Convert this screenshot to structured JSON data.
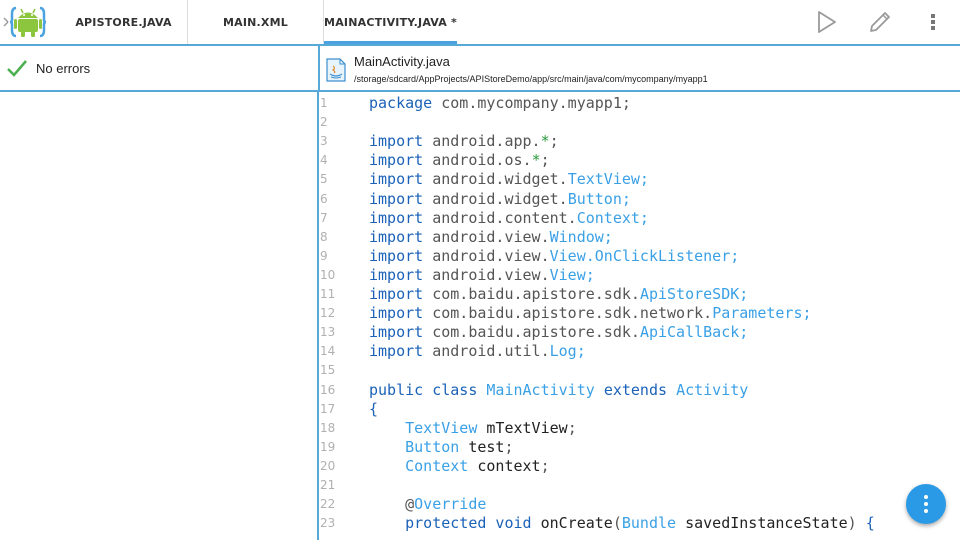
{
  "tabs": [
    {
      "label": "APISTORE.JAVA"
    },
    {
      "label": "MAIN.XML"
    },
    {
      "label": "MAINACTIVITY.JAVA *"
    }
  ],
  "toolbar": {
    "run_icon": "play-icon",
    "edit_icon": "pencil-icon",
    "menu_icon": "overflow-menu-icon"
  },
  "status": {
    "text": "No errors",
    "icon": "check-icon"
  },
  "file": {
    "name": "MainActivity.java",
    "path": "/storage/sdcard/AppProjects/APIStoreDemo/app/src/main/java/com/mycompany/myapp1",
    "icon": "java-file-icon"
  },
  "editor": {
    "lines": [
      {
        "n": "1",
        "html": "<span class='kw'>package</span> <span class='pl'>com.mycompany.myapp1;</span>"
      },
      {
        "n": "2",
        "html": ""
      },
      {
        "n": "3",
        "html": "<span class='kw'>import</span> <span class='pl'>android.app.</span><span class='gr'>*</span><span class='pl'>;</span>"
      },
      {
        "n": "4",
        "html": "<span class='kw'>import</span> <span class='pl'>android.os.</span><span class='gr'>*</span><span class='pl'>;</span>"
      },
      {
        "n": "5",
        "html": "<span class='kw'>import</span> <span class='pl'>android.widget.</span><span class='ty'>TextView;</span>"
      },
      {
        "n": "6",
        "html": "<span class='kw'>import</span> <span class='pl'>android.widget.</span><span class='ty'>Button;</span>"
      },
      {
        "n": "7",
        "html": "<span class='kw'>import</span> <span class='pl'>android.content.</span><span class='ty'>Context;</span>"
      },
      {
        "n": "8",
        "html": "<span class='kw'>import</span> <span class='pl'>android.view.</span><span class='ty'>Window;</span>"
      },
      {
        "n": "9",
        "html": "<span class='kw'>import</span> <span class='pl'>android.view.</span><span class='ty'>View.OnClickListener;</span>"
      },
      {
        "n": "10",
        "html": "<span class='kw'>import</span> <span class='pl'>android.view.</span><span class='ty'>View;</span>"
      },
      {
        "n": "11",
        "html": "<span class='kw'>import</span> <span class='pl'>com.baidu.apistore.sdk.</span><span class='ty'>ApiStoreSDK;</span>"
      },
      {
        "n": "12",
        "html": "<span class='kw'>import</span> <span class='pl'>com.baidu.apistore.sdk.network.</span><span class='ty'>Parameters;</span>"
      },
      {
        "n": "13",
        "html": "<span class='kw'>import</span> <span class='pl'>com.baidu.apistore.sdk.</span><span class='ty'>ApiCallBack;</span>"
      },
      {
        "n": "14",
        "html": "<span class='kw'>import</span> <span class='pl'>android.util.</span><span class='ty'>Log;</span>"
      },
      {
        "n": "15",
        "html": ""
      },
      {
        "n": "16",
        "html": "<span class='kw'>public class</span> <span class='ty'>MainActivity</span> <span class='kw'>extends</span> <span class='ty'>Activity</span>"
      },
      {
        "n": "17",
        "html": "<span class='kw'>{</span>"
      },
      {
        "n": "18",
        "html": "    <span class='ty'>TextView</span> <span class='dk'>mTextView</span><span class='pl'>;</span>"
      },
      {
        "n": "19",
        "html": "    <span class='ty'>Button</span> <span class='dk'>test</span><span class='pl'>;</span>"
      },
      {
        "n": "20",
        "html": "    <span class='ty'>Context</span> <span class='dk'>context</span><span class='pl'>;</span>"
      },
      {
        "n": "21",
        "html": ""
      },
      {
        "n": "22",
        "html": "    <span class='pl'>@</span><span class='ty'>Override</span>"
      },
      {
        "n": "23",
        "html": "    <span class='kw'>protected void</span> <span class='dk'>onCreate</span><span class='pl'>(</span><span class='ty'>Bundle</span> <span class='dk'>savedInstanceState</span><span class='pl'>)</span> <span class='kw'>{</span>"
      }
    ]
  },
  "fab": {
    "icon": "more-vertical-icon"
  }
}
